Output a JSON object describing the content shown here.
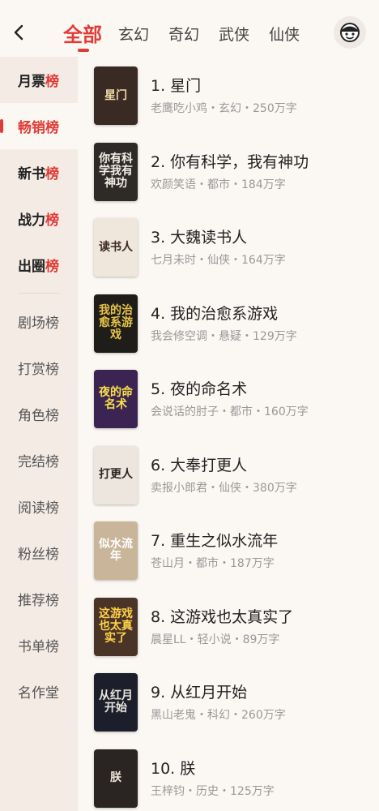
{
  "header": {
    "tabs": [
      {
        "label": "全部",
        "active": true
      },
      {
        "label": "玄幻"
      },
      {
        "label": "奇幻"
      },
      {
        "label": "武侠"
      },
      {
        "label": "仙侠"
      }
    ],
    "accent_color": "#e23b35"
  },
  "sidebar": {
    "primary": [
      {
        "label_prefix": "月票",
        "label_suffix": "榜"
      },
      {
        "label": "畅销榜",
        "active": true
      },
      {
        "label_prefix": "新书",
        "label_suffix": "榜"
      },
      {
        "label_prefix": "战力",
        "label_suffix": "榜"
      },
      {
        "label_prefix": "出圈",
        "label_suffix": "榜"
      }
    ],
    "secondary": [
      {
        "label": "剧场榜"
      },
      {
        "label": "打赏榜"
      },
      {
        "label": "角色榜"
      },
      {
        "label": "完结榜"
      },
      {
        "label": "阅读榜"
      },
      {
        "label": "粉丝榜"
      },
      {
        "label": "推荐榜"
      },
      {
        "label": "书单榜"
      },
      {
        "label": "名作堂"
      }
    ]
  },
  "books": [
    {
      "title": "1. 星门",
      "meta": "老鹰吃小鸡・玄幻・250万字",
      "cover_text": "星门",
      "cover_bg": "#3a2a24",
      "cover_fg": "#f2d9a8"
    },
    {
      "title": "2. 你有科学，我有神功",
      "meta": "欢颜笑语・都市・184万字",
      "cover_text": "你有科学我有神功",
      "cover_bg": "#2e2a28",
      "cover_fg": "#f3efe6"
    },
    {
      "title": "3. 大魏读书人",
      "meta": "七月未时・仙侠・164万字",
      "cover_text": "读书人",
      "cover_bg": "#efe7dc",
      "cover_fg": "#3b2a20"
    },
    {
      "title": "4. 我的治愈系游戏",
      "meta": "我会修空调・悬疑・129万字",
      "cover_text": "我的治愈系游戏",
      "cover_bg": "#1f1d1a",
      "cover_fg": "#e9c54a"
    },
    {
      "title": "5. 夜的命名术",
      "meta": "会说话的肘子・都市・160万字",
      "cover_text": "夜的命名术",
      "cover_bg": "#3b2452",
      "cover_fg": "#f7e04a"
    },
    {
      "title": "6. 大奉打更人",
      "meta": "卖报小郎君・仙侠・380万字",
      "cover_text": "打更人",
      "cover_bg": "#ece6df",
      "cover_fg": "#2a2420"
    },
    {
      "title": "7. 重生之似水流年",
      "meta": "苍山月・都市・187万字",
      "cover_text": "似水流年",
      "cover_bg": "#c9b59a",
      "cover_fg": "#ffffff"
    },
    {
      "title": "8. 这游戏也太真实了",
      "meta": "晨星LL・轻小说・89万字",
      "cover_text": "这游戏也太真实了",
      "cover_bg": "#4a3428",
      "cover_fg": "#ffd34a"
    },
    {
      "title": "9. 从红月开始",
      "meta": "黑山老鬼・科幻・260万字",
      "cover_text": "从红月开始",
      "cover_bg": "#1c1f2b",
      "cover_fg": "#e7e2da"
    },
    {
      "title": "10. 朕",
      "meta": "王梓钧・历史・125万字",
      "cover_text": "朕",
      "cover_bg": "#2a2523",
      "cover_fg": "#eee6da"
    }
  ]
}
